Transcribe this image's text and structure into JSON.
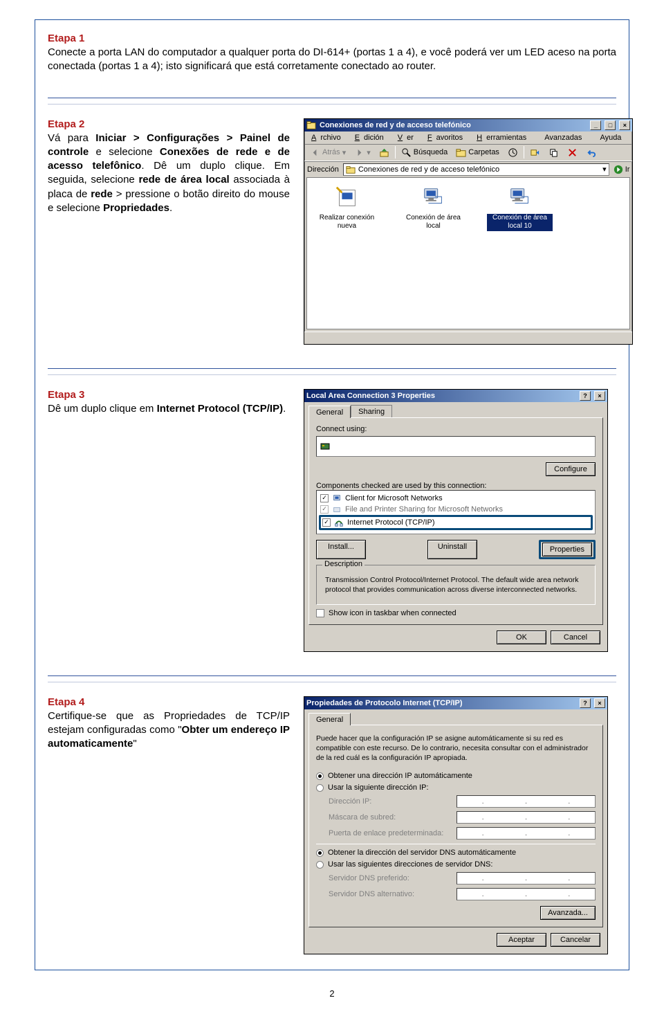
{
  "etapa1": {
    "title": "Etapa 1",
    "body_html": "Conecte a porta LAN do computador a qualquer porta do DI-614+ (portas 1 a 4), e você poderá ver um LED aceso na porta conectada (portas 1 a 4); isto significará que está corretamente conectado ao router."
  },
  "etapa2": {
    "title": "Etapa 2",
    "body_html": "Vá para <b>Iniciar > Configurações > Painel de controle</b> e selecione <b>Conexões de rede e de acesso telefônico</b>. Dê um duplo clique. Em seguida, selecione <b>rede de área local</b> associada à placa de <b>rede</b> > pressione o botão direito do mouse e selecione <b>Propriedades</b>."
  },
  "etapa3": {
    "title": "Etapa 3",
    "body_html": "Dê um duplo clique em <b>Internet Protocol (TCP/IP)</b>."
  },
  "etapa4": {
    "title": "Etapa 4",
    "body_html": "Certifique-se que as Propriedades de TCP/IP estejam configuradas como \"<b>Obter um endereço IP automaticamente</b>\""
  },
  "page_number": "2",
  "explorer": {
    "title": "Conexiones de red y de acceso telefónico",
    "menu": {
      "m0": "Archivo",
      "m1": "Edición",
      "m2": "Ver",
      "m3": "Favoritos",
      "m4": "Herramientas",
      "m5": "Avanzadas",
      "m6": "Ayuda"
    },
    "tb": {
      "back": "Atrás",
      "search": "Búsqueda",
      "folders": "Carpetas"
    },
    "addr_label": "Dirección",
    "addr_value": "Conexiones de red y de acceso telefónico",
    "go": "Ir",
    "items": {
      "i0": "Realizar conexión nueva",
      "i1": "Conexión de área local",
      "i2": "Conexión de área local 10"
    }
  },
  "lacp": {
    "title": "Local Area Connection 3 Properties",
    "tab_general": "General",
    "tab_sharing": "Sharing",
    "connect_using": "Connect using:",
    "configure": "Configure",
    "components_label": "Components checked are used by this connection:",
    "comp0": "Client for Microsoft Networks",
    "comp1": "File and Printer Sharing for Microsoft Networks",
    "comp2": "Internet Protocol (TCP/IP)",
    "install": "Install...",
    "uninstall": "Uninstall",
    "properties": "Properties",
    "desc_label": "Description",
    "desc_text": "Transmission Control Protocol/Internet Protocol. The default wide area network protocol that provides communication across diverse interconnected networks.",
    "show_icon": "Show icon in taskbar when connected",
    "ok": "OK",
    "cancel": "Cancel"
  },
  "tcpip": {
    "title": "Propiedades de Protocolo Internet (TCP/IP)",
    "tab_general": "General",
    "intro": "Puede hacer que la configuración IP se asigne automáticamente si su red es compatible con este recurso. De lo contrario, necesita consultar con el administrador de la red cuál es la configuración IP apropiada.",
    "r_auto_ip": "Obtener una dirección IP automáticamente",
    "r_manual_ip": "Usar la siguiente dirección IP:",
    "ip": "Dirección IP:",
    "mask": "Máscara de subred:",
    "gw": "Puerta de enlace predeterminada:",
    "r_auto_dns": "Obtener la dirección del servidor DNS automáticamente",
    "r_manual_dns": "Usar las siguientes direcciones de servidor DNS:",
    "dns1": "Servidor DNS preferido:",
    "dns2": "Servidor DNS alternativo:",
    "advanced": "Avanzada...",
    "accept": "Aceptar",
    "cancel": "Cancelar"
  }
}
